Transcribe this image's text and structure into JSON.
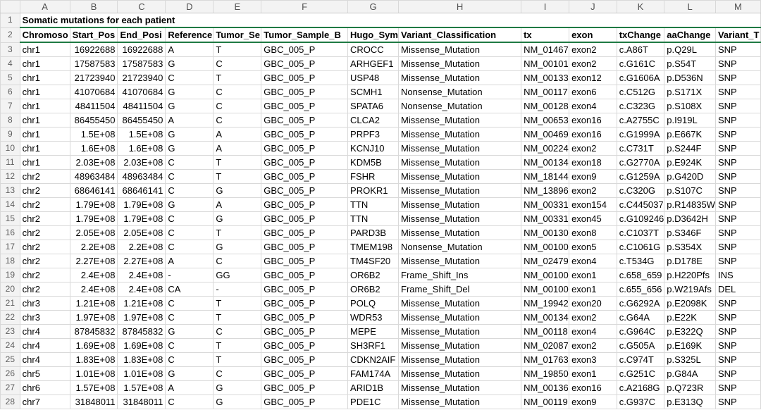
{
  "columns": [
    "A",
    "B",
    "C",
    "D",
    "E",
    "F",
    "G",
    "H",
    "I",
    "J",
    "K",
    "L",
    "M"
  ],
  "title_row": {
    "row_number": "1",
    "text": "Somatic mutations for each patient"
  },
  "header_row": {
    "row_number": "2",
    "cells": [
      "Chromoso",
      "Start_Pos",
      "End_Posi",
      "Reference",
      "Tumor_Se",
      "Tumor_Sample_B",
      "Hugo_Sym",
      "Variant_Classification",
      "tx",
      "exon",
      "txChange",
      "aaChange",
      "Variant_T"
    ]
  },
  "rows": [
    {
      "n": "3",
      "cells": [
        "chr1",
        "16922688",
        "16922688",
        "A",
        "T",
        "GBC_005_P",
        "CROCC",
        "Missense_Mutation",
        "NM_01467",
        "exon2",
        "c.A86T",
        "p.Q29L",
        "SNP"
      ]
    },
    {
      "n": "4",
      "cells": [
        "chr1",
        "17587583",
        "17587583",
        "G",
        "C",
        "GBC_005_P",
        "ARHGEF1",
        "Missense_Mutation",
        "NM_00101",
        "exon2",
        "c.G161C",
        "p.S54T",
        "SNP"
      ]
    },
    {
      "n": "5",
      "cells": [
        "chr1",
        "21723940",
        "21723940",
        "C",
        "T",
        "GBC_005_P",
        "USP48",
        "Missense_Mutation",
        "NM_00133",
        "exon12",
        "c.G1606A",
        "p.D536N",
        "SNP"
      ]
    },
    {
      "n": "6",
      "cells": [
        "chr1",
        "41070684",
        "41070684",
        "G",
        "C",
        "GBC_005_P",
        "SCMH1",
        "Nonsense_Mutation",
        "NM_00117",
        "exon6",
        "c.C512G",
        "p.S171X",
        "SNP"
      ]
    },
    {
      "n": "7",
      "cells": [
        "chr1",
        "48411504",
        "48411504",
        "G",
        "C",
        "GBC_005_P",
        "SPATA6",
        "Nonsense_Mutation",
        "NM_00128",
        "exon4",
        "c.C323G",
        "p.S108X",
        "SNP"
      ]
    },
    {
      "n": "8",
      "cells": [
        "chr1",
        "86455450",
        "86455450",
        "A",
        "C",
        "GBC_005_P",
        "CLCA2",
        "Missense_Mutation",
        "NM_00653",
        "exon16",
        "c.A2755C",
        "p.I919L",
        "SNP"
      ]
    },
    {
      "n": "9",
      "cells": [
        "chr1",
        "1.5E+08",
        "1.5E+08",
        "G",
        "A",
        "GBC_005_P",
        "PRPF3",
        "Missense_Mutation",
        "NM_00469",
        "exon16",
        "c.G1999A",
        "p.E667K",
        "SNP"
      ]
    },
    {
      "n": "10",
      "cells": [
        "chr1",
        "1.6E+08",
        "1.6E+08",
        "G",
        "A",
        "GBC_005_P",
        "KCNJ10",
        "Missense_Mutation",
        "NM_00224",
        "exon2",
        "c.C731T",
        "p.S244F",
        "SNP"
      ]
    },
    {
      "n": "11",
      "cells": [
        "chr1",
        "2.03E+08",
        "2.03E+08",
        "C",
        "T",
        "GBC_005_P",
        "KDM5B",
        "Missense_Mutation",
        "NM_00134",
        "exon18",
        "c.G2770A",
        "p.E924K",
        "SNP"
      ]
    },
    {
      "n": "12",
      "cells": [
        "chr2",
        "48963484",
        "48963484",
        "C",
        "T",
        "GBC_005_P",
        "FSHR",
        "Missense_Mutation",
        "NM_18144",
        "exon9",
        "c.G1259A",
        "p.G420D",
        "SNP"
      ]
    },
    {
      "n": "13",
      "cells": [
        "chr2",
        "68646141",
        "68646141",
        "C",
        "G",
        "GBC_005_P",
        "PROKR1",
        "Missense_Mutation",
        "NM_13896",
        "exon2",
        "c.C320G",
        "p.S107C",
        "SNP"
      ]
    },
    {
      "n": "14",
      "cells": [
        "chr2",
        "1.79E+08",
        "1.79E+08",
        "G",
        "A",
        "GBC_005_P",
        "TTN",
        "Missense_Mutation",
        "NM_00331",
        "exon154",
        "c.C445037",
        "p.R14835W",
        "SNP"
      ]
    },
    {
      "n": "15",
      "cells": [
        "chr2",
        "1.79E+08",
        "1.79E+08",
        "C",
        "G",
        "GBC_005_P",
        "TTN",
        "Missense_Mutation",
        "NM_00331",
        "exon45",
        "c.G109246",
        "p.D3642H",
        "SNP"
      ]
    },
    {
      "n": "16",
      "cells": [
        "chr2",
        "2.05E+08",
        "2.05E+08",
        "C",
        "T",
        "GBC_005_P",
        "PARD3B",
        "Missense_Mutation",
        "NM_00130",
        "exon8",
        "c.C1037T",
        "p.S346F",
        "SNP"
      ]
    },
    {
      "n": "17",
      "cells": [
        "chr2",
        "2.2E+08",
        "2.2E+08",
        "C",
        "G",
        "GBC_005_P",
        "TMEM198",
        "Nonsense_Mutation",
        "NM_00100",
        "exon5",
        "c.C1061G",
        "p.S354X",
        "SNP"
      ]
    },
    {
      "n": "18",
      "cells": [
        "chr2",
        "2.27E+08",
        "2.27E+08",
        "A",
        "C",
        "GBC_005_P",
        "TM4SF20",
        "Missense_Mutation",
        "NM_02479",
        "exon4",
        "c.T534G",
        "p.D178E",
        "SNP"
      ]
    },
    {
      "n": "19",
      "cells": [
        "chr2",
        "2.4E+08",
        "2.4E+08",
        "-",
        "GG",
        "GBC_005_P",
        "OR6B2",
        "Frame_Shift_Ins",
        "NM_00100",
        "exon1",
        "c.658_659",
        "p.H220Pfs",
        "INS"
      ]
    },
    {
      "n": "20",
      "cells": [
        "chr2",
        "2.4E+08",
        "2.4E+08",
        "CA",
        "-",
        "GBC_005_P",
        "OR6B2",
        "Frame_Shift_Del",
        "NM_00100",
        "exon1",
        "c.655_656",
        "p.W219Afs",
        "DEL"
      ]
    },
    {
      "n": "21",
      "cells": [
        "chr3",
        "1.21E+08",
        "1.21E+08",
        "C",
        "T",
        "GBC_005_P",
        "POLQ",
        "Missense_Mutation",
        "NM_19942",
        "exon20",
        "c.G6292A",
        "p.E2098K",
        "SNP"
      ]
    },
    {
      "n": "22",
      "cells": [
        "chr3",
        "1.97E+08",
        "1.97E+08",
        "C",
        "T",
        "GBC_005_P",
        "WDR53",
        "Missense_Mutation",
        "NM_00134",
        "exon2",
        "c.G64A",
        "p.E22K",
        "SNP"
      ]
    },
    {
      "n": "23",
      "cells": [
        "chr4",
        "87845832",
        "87845832",
        "G",
        "C",
        "GBC_005_P",
        "MEPE",
        "Missense_Mutation",
        "NM_00118",
        "exon4",
        "c.G964C",
        "p.E322Q",
        "SNP"
      ]
    },
    {
      "n": "24",
      "cells": [
        "chr4",
        "1.69E+08",
        "1.69E+08",
        "C",
        "T",
        "GBC_005_P",
        "SH3RF1",
        "Missense_Mutation",
        "NM_02087",
        "exon2",
        "c.G505A",
        "p.E169K",
        "SNP"
      ]
    },
    {
      "n": "25",
      "cells": [
        "chr4",
        "1.83E+08",
        "1.83E+08",
        "C",
        "T",
        "GBC_005_P",
        "CDKN2AIF",
        "Missense_Mutation",
        "NM_01763",
        "exon3",
        "c.C974T",
        "p.S325L",
        "SNP"
      ]
    },
    {
      "n": "26",
      "cells": [
        "chr5",
        "1.01E+08",
        "1.01E+08",
        "G",
        "C",
        "GBC_005_P",
        "FAM174A",
        "Missense_Mutation",
        "NM_19850",
        "exon1",
        "c.G251C",
        "p.G84A",
        "SNP"
      ]
    },
    {
      "n": "27",
      "cells": [
        "chr6",
        "1.57E+08",
        "1.57E+08",
        "A",
        "G",
        "GBC_005_P",
        "ARID1B",
        "Missense_Mutation",
        "NM_00136",
        "exon16",
        "c.A2168G",
        "p.Q723R",
        "SNP"
      ]
    },
    {
      "n": "28",
      "cells": [
        "chr7",
        "31848011",
        "31848011",
        "C",
        "G",
        "GBC_005_P",
        "PDE1C",
        "Missense_Mutation",
        "NM_00119",
        "exon9",
        "c.G937C",
        "p.E313Q",
        "SNP"
      ]
    }
  ],
  "colors": {
    "header_accent": "#1f7a43",
    "gridline": "#d9d9d9",
    "heading_bg": "#f3f3f3"
  }
}
